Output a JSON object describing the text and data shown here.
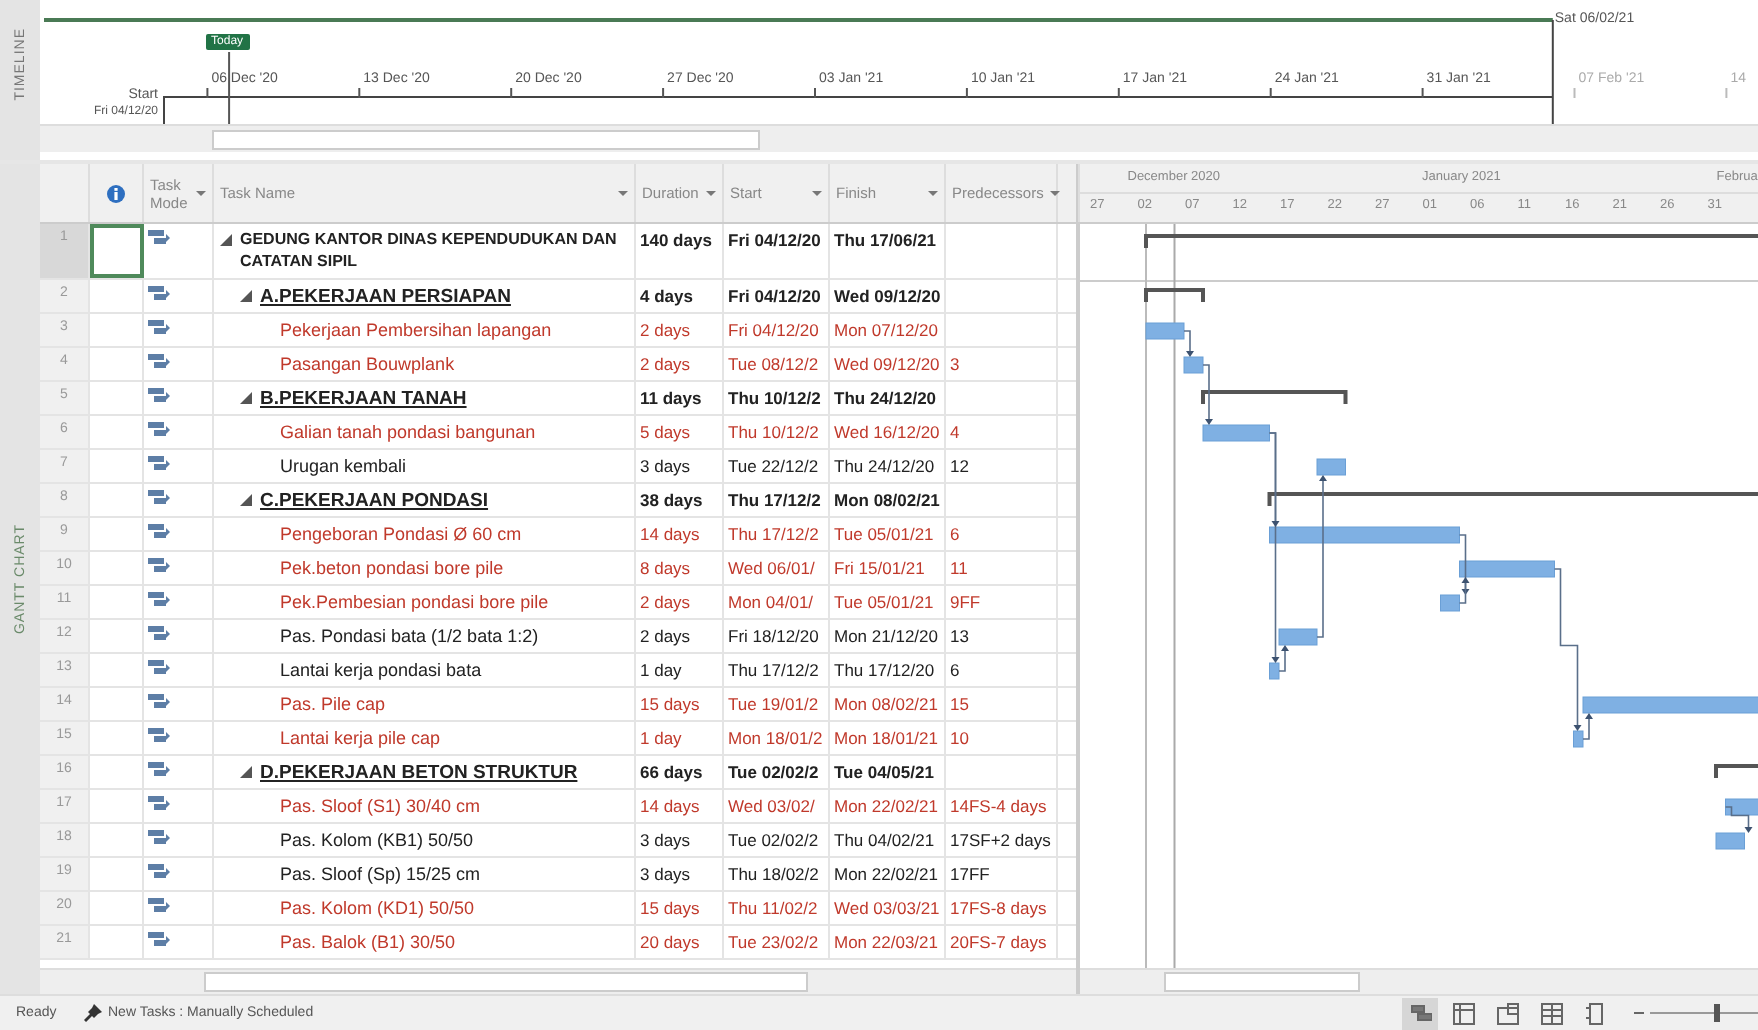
{
  "timeline": {
    "label": "TIMELINE",
    "today_label": "Today",
    "ticks": [
      "06 Dec '20",
      "13 Dec '20",
      "20 Dec '20",
      "27 Dec '20",
      "03 Jan '21",
      "10 Jan '21",
      "17 Jan '21",
      "24 Jan '21",
      "31 Jan '21",
      "07 Feb '21",
      "14"
    ],
    "start_label": "Start",
    "start_text": "Fri 04/12/20",
    "finish_text": "Sat 06/02/21"
  },
  "view_label": "GANTT CHART",
  "columns": [
    {
      "kind": "indicator"
    },
    {
      "kind": "mode",
      "label": "Task Mode"
    },
    {
      "kind": "name",
      "label": "Task Name"
    },
    {
      "kind": "duration",
      "label": "Duration"
    },
    {
      "kind": "start",
      "label": "Start"
    },
    {
      "kind": "finish",
      "label": "Finish"
    },
    {
      "kind": "pred",
      "label": "Predecessors"
    }
  ],
  "tasks": [
    {
      "id": "1",
      "name": "GEDUNG KANTOR DINAS KEPENDUDUKAN DAN CATATAN SIPIL",
      "duration": "140 days",
      "start": "Fri 04/12/20",
      "finish": "Thu 17/06/21",
      "selected": true,
      "critical": false,
      "expanded": true,
      "children": [
        {
          "id": "2",
          "name": "A.PEKERJAAN PERSIAPAN",
          "duration": "4 days",
          "start": "Fri 04/12/20",
          "finish": "Wed 09/12/20",
          "selected": false,
          "critical": false,
          "expanded": true,
          "children": [
            {
              "id": "3",
              "name": "Pekerjaan Pembersihan lapangan",
              "duration": "2 days",
              "start": "Fri 04/12/20",
              "finish": "Mon 07/12/20",
              "selected": false,
              "critical": true
            },
            {
              "id": "4",
              "name": "Pasangan Bouwplank",
              "duration": "2 days",
              "start": "Tue 08/12/2",
              "finish": "Wed 09/12/20",
              "pred": "3",
              "selected": false,
              "critical": true
            }
          ]
        },
        {
          "id": "5",
          "name": "B.PEKERJAAN TANAH",
          "duration": "11 days",
          "start": "Thu 10/12/2",
          "finish": "Thu 24/12/20",
          "selected": false,
          "critical": false,
          "expanded": true,
          "children": [
            {
              "id": "6",
              "name": "Galian tanah pondasi bangunan",
              "duration": "5 days",
              "start": "Thu 10/12/2",
              "finish": "Wed 16/12/20",
              "pred": "4",
              "selected": false,
              "critical": true
            },
            {
              "id": "7",
              "name": "Urugan kembali",
              "duration": "3 days",
              "start": "Tue 22/12/2",
              "finish": "Thu 24/12/20",
              "pred": "12",
              "selected": false,
              "critical": false
            }
          ]
        },
        {
          "id": "8",
          "name": "C.PEKERJAAN PONDASI",
          "duration": "38 days",
          "start": "Thu 17/12/2",
          "finish": "Mon 08/02/21",
          "selected": false,
          "critical": false,
          "expanded": true,
          "children": [
            {
              "id": "9",
              "name": "Pengeboran Pondasi Ø 60 cm",
              "duration": "14 days",
              "start": "Thu 17/12/2",
              "finish": "Tue 05/01/21",
              "pred": "6",
              "selected": false,
              "critical": true
            },
            {
              "id": "10",
              "name": "Pek.beton pondasi bore pile",
              "duration": "8 days",
              "start": "Wed 06/01/",
              "finish": "Fri 15/01/21",
              "pred": "11",
              "selected": false,
              "critical": true
            },
            {
              "id": "11",
              "name": "Pek.Pembesian pondasi bore pile",
              "duration": "2 days",
              "start": "Mon 04/01/",
              "finish": "Tue 05/01/21",
              "pred": "9FF",
              "selected": false,
              "critical": true
            },
            {
              "id": "12",
              "name": "Pas. Pondasi bata (1/2 bata 1:2)",
              "duration": "2 days",
              "start": "Fri 18/12/20",
              "finish": "Mon 21/12/20",
              "pred": "13",
              "selected": false,
              "critical": false
            },
            {
              "id": "13",
              "name": "Lantai kerja pondasi bata",
              "duration": "1 day",
              "start": "Thu 17/12/2",
              "finish": "Thu 17/12/20",
              "pred": "6",
              "selected": false,
              "critical": false
            },
            {
              "id": "14",
              "name": "Pas. Pile cap",
              "duration": "15 days",
              "start": "Tue 19/01/2",
              "finish": "Mon 08/02/21",
              "pred": "15",
              "selected": false,
              "critical": true
            },
            {
              "id": "15",
              "name": "Lantai kerja pile cap",
              "duration": "1 day",
              "start": "Mon 18/01/2",
              "finish": "Mon 18/01/21",
              "pred": "10",
              "selected": false,
              "critical": true
            }
          ]
        },
        {
          "id": "16",
          "name": "D.PEKERJAAN BETON STRUKTUR",
          "duration": "66 days",
          "start": "Tue 02/02/2",
          "finish": "Tue 04/05/21",
          "selected": false,
          "critical": false,
          "expanded": true,
          "children": [
            {
              "id": "17",
              "name": "Pas. Sloof (S1) 30/40 cm",
              "duration": "14 days",
              "start": "Wed 03/02/",
              "finish": "Mon 22/02/21",
              "pred": "14FS-4 days",
              "selected": false,
              "critical": true
            },
            {
              "id": "18",
              "name": "Pas. Kolom (KB1) 50/50",
              "duration": "3 days",
              "start": "Tue 02/02/2",
              "finish": "Thu 04/02/21",
              "pred": "17SF+2 days",
              "selected": false,
              "critical": false
            },
            {
              "id": "19",
              "name": "Pas. Sloof (Sp) 15/25 cm",
              "duration": "3 days",
              "start": "Thu 18/02/2",
              "finish": "Mon 22/02/21",
              "pred": "17FF",
              "selected": false,
              "critical": false
            },
            {
              "id": "20",
              "name": "Pas. Kolom (KD1) 50/50",
              "duration": "15 days",
              "start": "Thu 11/02/2",
              "finish": "Wed 03/03/21",
              "pred": "17FS-8 days",
              "selected": false,
              "critical": true
            },
            {
              "id": "21",
              "name": "Pas. Balok (B1) 30/50",
              "duration": "20 days",
              "start": "Tue 23/02/2",
              "finish": "Mon 22/03/21",
              "pred": "20FS-7 days",
              "selected": false,
              "critical": true
            }
          ]
        }
      ]
    }
  ],
  "gantt": {
    "months": [
      "December 2020",
      "January 2021",
      "Februa"
    ],
    "day_labels": [
      "27",
      "02",
      "07",
      "12",
      "17",
      "22",
      "27",
      "01",
      "06",
      "11",
      "16",
      "21",
      "26",
      "31"
    ]
  },
  "status_bar": {
    "ready": "Ready",
    "new_tasks": "New Tasks : Manually Scheduled",
    "views": [
      {
        "kind": "gantt",
        "selected": true
      },
      {
        "kind": "usage",
        "selected": false
      },
      {
        "kind": "planner",
        "selected": false
      },
      {
        "kind": "sheet",
        "selected": false
      },
      {
        "kind": "report",
        "selected": false
      }
    ],
    "zoom": {
      "level": 0.62
    }
  }
}
